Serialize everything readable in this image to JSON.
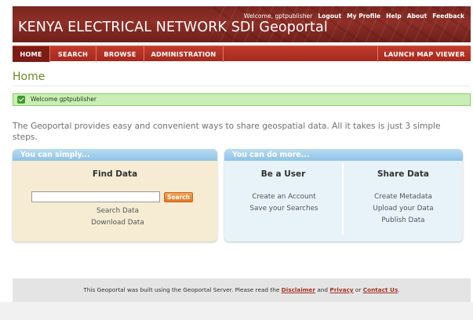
{
  "header": {
    "site_title": "KENYA ELECTRICAL NETWORK SDI Geoportal",
    "welcome_text": "Welcome, gptpublisher",
    "links": [
      "Logout",
      "My Profile",
      "Help",
      "About",
      "Feedback"
    ]
  },
  "nav": {
    "home": "HOME",
    "search": "SEARCH",
    "browse": "BROWSE",
    "administration": "ADMINISTRATION",
    "launch_map_viewer": "LAUNCH MAP VIEWER"
  },
  "page": {
    "title": "Home",
    "message": "Welcome gptpublisher",
    "intro": "The Geoportal provides easy and convenient ways to share geospatial data. All it takes is just 3 simple steps."
  },
  "panels": {
    "left_header": "You can simply...",
    "right_header": "You can do more...",
    "find_data": {
      "title": "Find Data",
      "search_button": "Search",
      "search_value": "",
      "links": [
        "Search Data",
        "Download Data"
      ]
    },
    "be_a_user": {
      "title": "Be a User",
      "links": [
        "Create an Account",
        "Save your Searches"
      ]
    },
    "share_data": {
      "title": "Share Data",
      "links": [
        "Create Metadata",
        "Upload your Data",
        "Publish Data"
      ]
    }
  },
  "footer": {
    "text_before": "This Geoportal was built using the Geoportal Server. Please read the",
    "disclaimer": "Disclaimer",
    "and": "and",
    "privacy": "Privacy",
    "or": "or",
    "contact": "Contact Us",
    "end": "."
  },
  "colors": {
    "header_bg": "#8e2f27",
    "nav_bg": "#b3321f",
    "title_green": "#6b8a22",
    "message_bg": "#c9efb6",
    "left_panel_bg": "#f5ecd3",
    "right_panel_bg": "#e8f2f9",
    "panel_header_blue": "#8fc3e6",
    "search_button_orange": "#e07a26"
  }
}
